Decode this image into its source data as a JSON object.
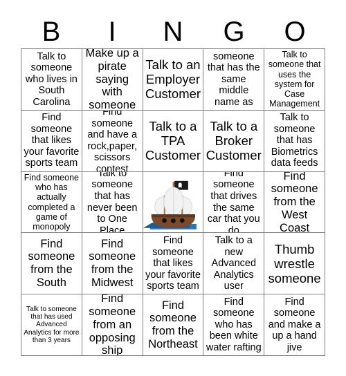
{
  "card": {
    "title": "BINGO",
    "header_letters": [
      "B",
      "I",
      "N",
      "G",
      "O"
    ],
    "grid_line_color": "#7f7f7f",
    "background_color": "#ffffff",
    "text_color": "#000000"
  },
  "free_space": {
    "icon": "pirate-ship-icon",
    "label": "Pirate ship free space",
    "colors": {
      "hull": "#7b4a2a",
      "hull_shadow": "#5d3720",
      "sail": "#f2f2f2",
      "sail_shade": "#d9d9d9",
      "mast": "#a9713f",
      "flag": "#1a1a1a",
      "skull": "#ffffff",
      "water": "#2e75b6",
      "water_dark": "#1f5c96"
    }
  },
  "cells": [
    [
      {
        "text": "Talk to someone who lives in South Carolina",
        "size": "md"
      },
      {
        "text": "Make up a pirate saying with someone",
        "size": "lg"
      },
      {
        "text": "Talk to an Employer Customer",
        "size": "xl"
      },
      {
        "text": "Find someone that has the same middle name as you",
        "size": "md"
      },
      {
        "text": "Talk to someone that uses the system for Case Management",
        "size": "sm"
      }
    ],
    [
      {
        "text": "Find someone that likes your favorite sports team",
        "size": "md"
      },
      {
        "text": "Find someone and have a rock,paper, scissors contest",
        "size": "md"
      },
      {
        "text": "Talk to a TPA Customer",
        "size": "xl"
      },
      {
        "text": "Talk to a Broker Customer",
        "size": "xl"
      },
      {
        "text": "Talk to someone that has Biometrics data feeds",
        "size": "md"
      }
    ],
    [
      {
        "text": "Find someone who has actually completed a game of monopoly",
        "size": "sm"
      },
      {
        "text": "Talk to someone that has never been to One Place",
        "size": "md"
      },
      {
        "text": "",
        "size": "md",
        "free": true
      },
      {
        "text": "Find someone that drives the same car that you do",
        "size": "md"
      },
      {
        "text": "Find someone from the West Coast",
        "size": "lg"
      }
    ],
    [
      {
        "text": "Find someone from the South",
        "size": "lg"
      },
      {
        "text": "Find someone from the Midwest",
        "size": "lg"
      },
      {
        "text": "Find someone that likes your favorite sports team",
        "size": "md"
      },
      {
        "text": "Talk to a new Advanced Analytics user",
        "size": "md"
      },
      {
        "text": "Thumb wrestle someone",
        "size": "xl"
      }
    ],
    [
      {
        "text": "Talk to someone that has used Advanced Analytics for more than 3 years",
        "size": "xs"
      },
      {
        "text": "Find someone from an opposing ship",
        "size": "lg"
      },
      {
        "text": "Find someone from the Northeast",
        "size": "lg"
      },
      {
        "text": "Find someone who has been white water rafting",
        "size": "md"
      },
      {
        "text": "Find someone and make a up a hand jive",
        "size": "md"
      }
    ]
  ]
}
